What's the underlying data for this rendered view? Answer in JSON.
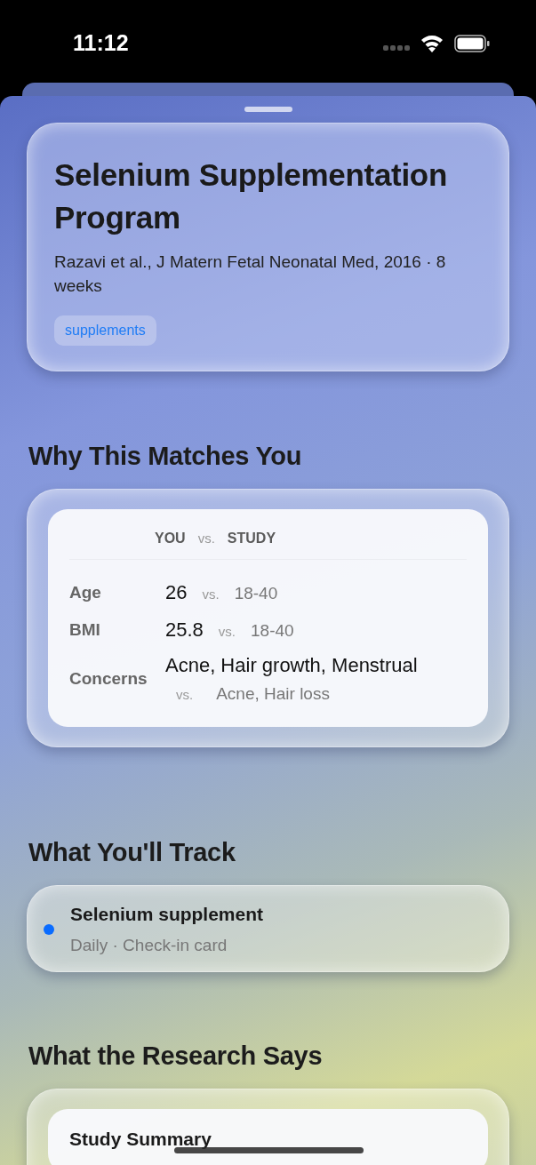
{
  "status_bar": {
    "time": "11:12"
  },
  "program": {
    "title": "Selenium Supplementation Program",
    "citation": "Razavi et al., J Matern Fetal Neonatal Med, 2016 · 8 weeks",
    "tags": [
      "supplements"
    ]
  },
  "match": {
    "heading": "Why This Matches You",
    "header": {
      "you": "YOU",
      "vs": "vs.",
      "study": "STUDY"
    },
    "rows": [
      {
        "label": "Age",
        "you": "26",
        "vs": "vs.",
        "study": "18-40",
        "kind": "inline"
      },
      {
        "label": "BMI",
        "you": "25.8",
        "vs": "vs.",
        "study": "18-40",
        "kind": "inline"
      },
      {
        "label": "Concerns",
        "you": "Acne, Hair growth, Menstrual",
        "vs": "vs.",
        "study": "Acne, Hair loss",
        "kind": "stacked"
      }
    ]
  },
  "track": {
    "heading": "What You'll Track",
    "items": [
      {
        "name": "Selenium supplement",
        "detail": "Daily · Check-in card"
      }
    ]
  },
  "research": {
    "heading": "What the Research Says",
    "card_title": "Study Summary"
  }
}
